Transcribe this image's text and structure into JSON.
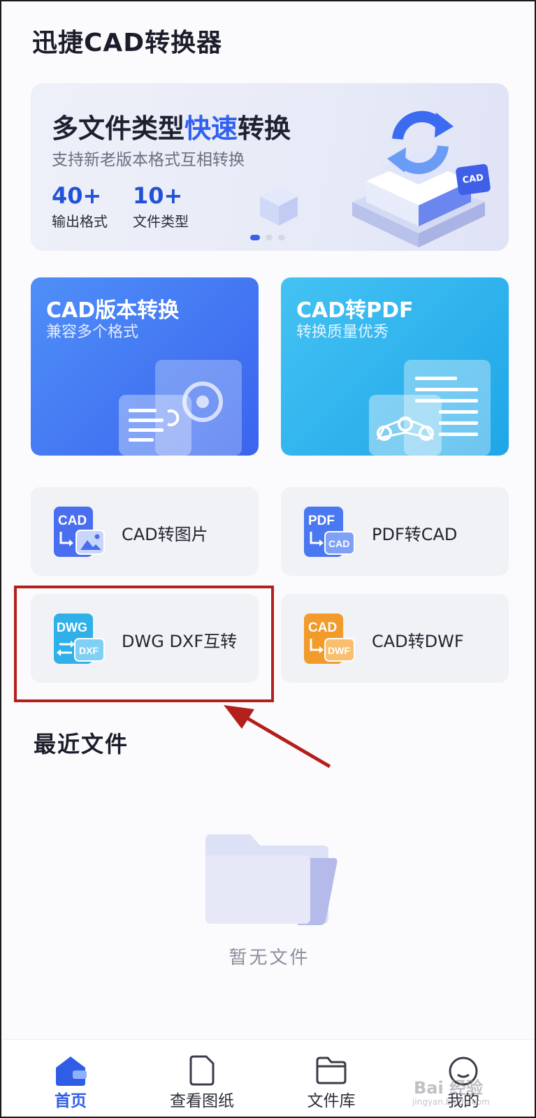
{
  "app": {
    "title": "迅捷CAD转换器"
  },
  "banner": {
    "title_before": "多文件类型",
    "title_highlight": "快速",
    "title_after": "转换",
    "subtitle": "支持新老版本格式互相转换",
    "stats": [
      {
        "value": "40+",
        "label": "输出格式"
      },
      {
        "value": "10+",
        "label": "文件类型"
      }
    ],
    "badge_text": "CAD",
    "active_slide": 1,
    "slide_count": 3
  },
  "features": [
    {
      "title": "CAD版本转换",
      "subtitle": "兼容多个格式"
    },
    {
      "title": "CAD转PDF",
      "subtitle": "转换质量优秀"
    }
  ],
  "tools": [
    {
      "label": "CAD转图片",
      "icon_top": "CAD",
      "icon_name": "cad-to-image-icon",
      "color": "#4a6ef0"
    },
    {
      "label": "PDF转CAD",
      "icon_top": "PDF",
      "icon_bottom": "CAD",
      "icon_name": "pdf-to-cad-icon",
      "color": "#4a78f0"
    },
    {
      "label": "DWG DXF互转",
      "icon_top": "DWG",
      "icon_bottom": "DXF",
      "icon_name": "dwg-dxf-convert-icon",
      "color": "#2fb0e8"
    },
    {
      "label": "CAD转DWF",
      "icon_top": "CAD",
      "icon_bottom": "DWF",
      "icon_name": "cad-to-dwf-icon",
      "color": "#f29a2a"
    }
  ],
  "recent": {
    "title": "最近文件",
    "empty_text": "暂无文件"
  },
  "nav": {
    "items": [
      {
        "label": "首页",
        "icon": "home-icon",
        "active": true
      },
      {
        "label": "查看图纸",
        "icon": "drawing-icon",
        "active": false
      },
      {
        "label": "文件库",
        "icon": "folder-icon",
        "active": false
      },
      {
        "label": "我的",
        "icon": "profile-icon",
        "active": false
      }
    ]
  },
  "watermark": {
    "text": "Bai 经验",
    "sub": "jingyan.baidu.com"
  },
  "colors": {
    "accent": "#2f5de6",
    "highlight_box": "#b3201b",
    "arrow": "#b3201b"
  }
}
